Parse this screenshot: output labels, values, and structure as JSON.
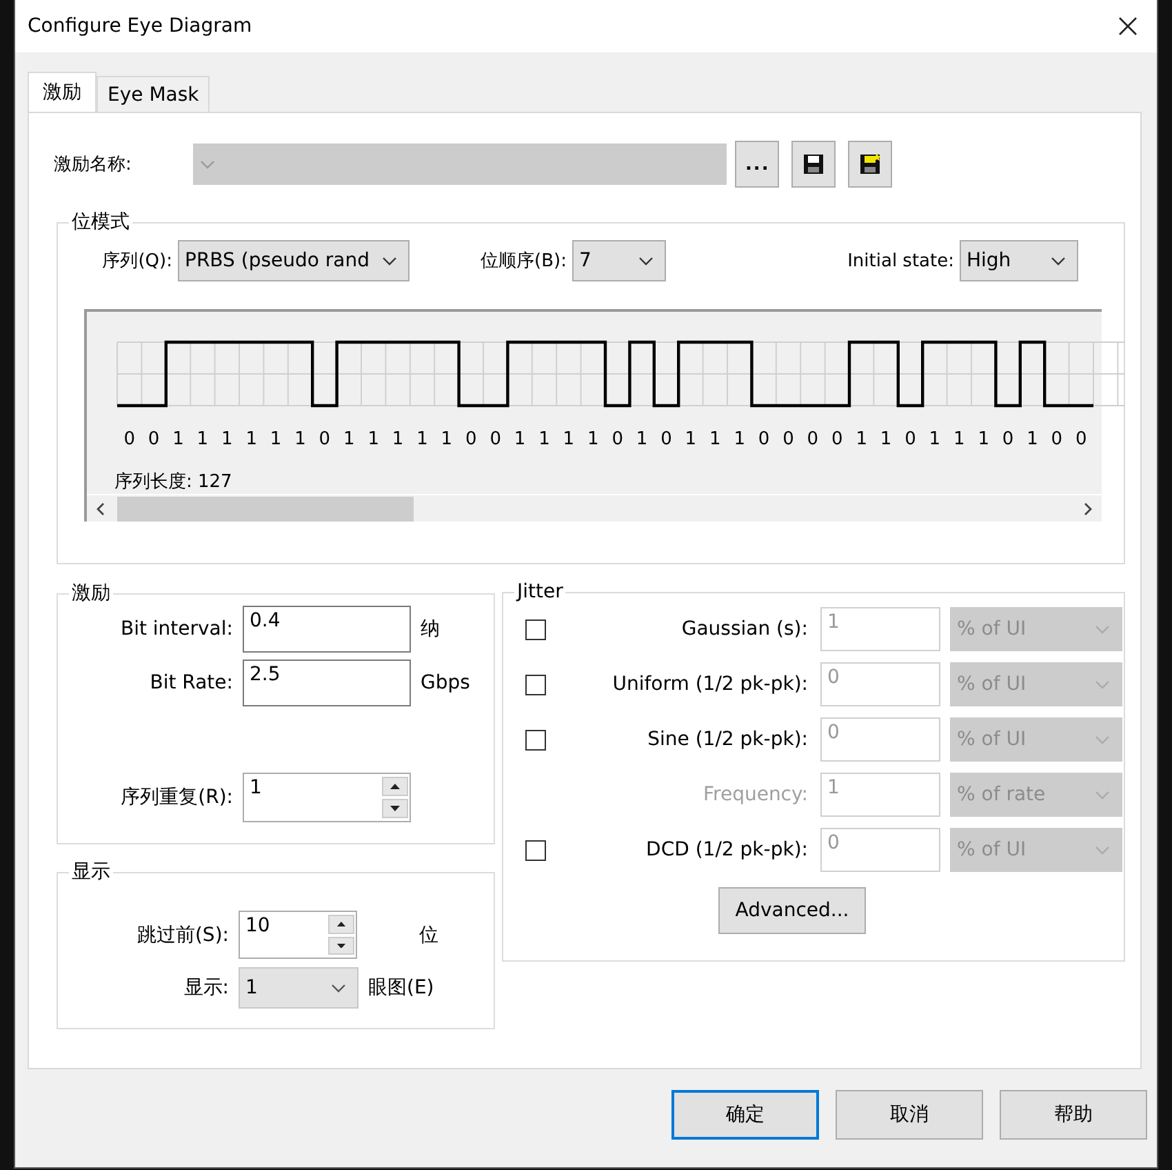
{
  "window": {
    "title": "Configure Eye Diagram"
  },
  "tabs": [
    {
      "label": "激励",
      "selected": true
    },
    {
      "label": "Eye Mask",
      "selected": false
    }
  ],
  "stimulus_name": {
    "label": "激励名称:",
    "disabled": true
  },
  "name_buttons": [
    {
      "kind": "text",
      "label": "..."
    },
    {
      "kind": "save"
    },
    {
      "kind": "save_as"
    }
  ],
  "bit_pattern": {
    "title": "位模式",
    "sequence": {
      "label": "序列(Q):",
      "value": "PRBS (pseudo rand"
    },
    "bit_order": {
      "label": "位顺序(B):",
      "value": "7"
    },
    "initial_state": {
      "label": "Initial state:",
      "value": "High"
    },
    "bits": [
      "0",
      "0",
      "1",
      "1",
      "1",
      "1",
      "1",
      "1",
      "0",
      "1",
      "1",
      "1",
      "1",
      "1",
      "0",
      "0",
      "1",
      "1",
      "1",
      "1",
      "0",
      "1",
      "0",
      "1",
      "1",
      "1",
      "0",
      "0",
      "0",
      "0",
      "1",
      "1",
      "0",
      "1",
      "1",
      "1",
      "0",
      "1",
      "0",
      "0"
    ],
    "length_label": "序列长度: 127"
  },
  "stimulus": {
    "title": "激励",
    "fields": [
      {
        "label": "Bit interval:",
        "value": "0.4",
        "unit": "纳"
      },
      {
        "label": "Bit Rate:",
        "value": "2.5",
        "unit": "Gbps"
      }
    ],
    "repeat": {
      "label": "序列重复(R):",
      "value": "1"
    }
  },
  "display": {
    "title": "显示",
    "skip": {
      "label": "跳过前(S):",
      "value": "10",
      "unit": "位"
    },
    "show": {
      "label": "显示:",
      "value": "1",
      "unit": "眼图(E)"
    }
  },
  "jitter": {
    "title": "Jitter",
    "inputs_disabled": true,
    "rows": [
      {
        "kind": "checkbox",
        "checked": false,
        "label": "Gaussian (s):",
        "value": "1",
        "unit": "% of UI"
      },
      {
        "kind": "checkbox",
        "checked": false,
        "label": "Uniform (1/2 pk-pk):",
        "value": "0",
        "unit": "% of UI"
      },
      {
        "kind": "checkbox",
        "checked": false,
        "label": "Sine (1/2 pk-pk):",
        "value": "0",
        "unit": "% of UI"
      },
      {
        "kind": "plain",
        "disabled": true,
        "label": "Frequency:",
        "value": "1",
        "unit": "% of rate"
      },
      {
        "kind": "checkbox",
        "checked": false,
        "label": "DCD (1/2 pk-pk):",
        "value": "0",
        "unit": "% of UI"
      }
    ],
    "advanced": "Advanced..."
  },
  "buttons": [
    {
      "label": "确定",
      "default": true
    },
    {
      "label": "取消",
      "default": false
    },
    {
      "label": "帮助",
      "default": false
    }
  ]
}
